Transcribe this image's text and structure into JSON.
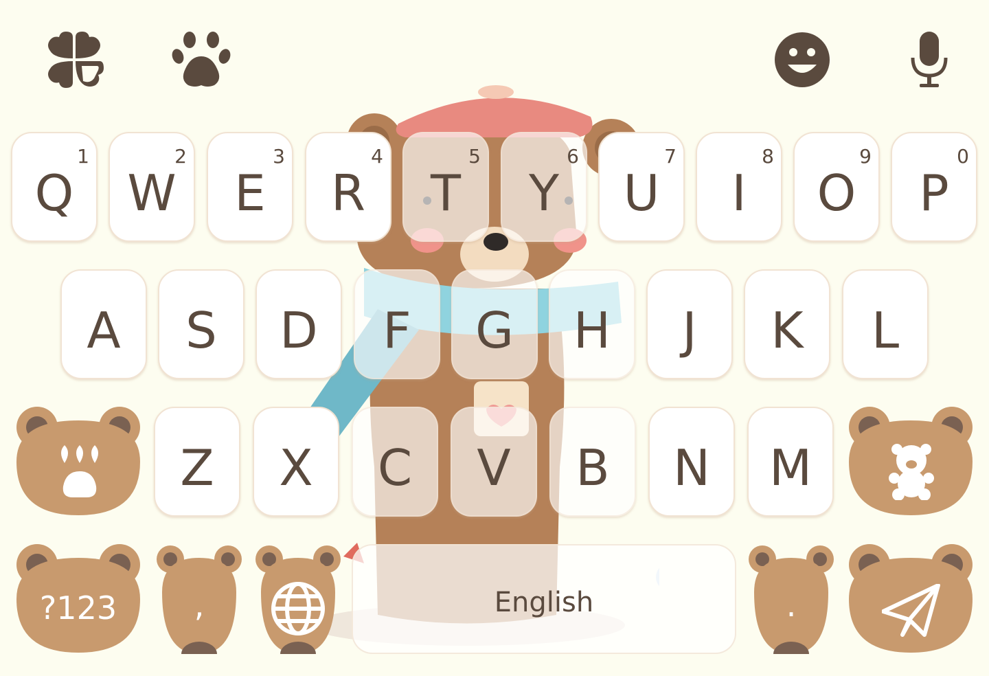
{
  "colors": {
    "background": "#fdfdf0",
    "key_fill": "#ffffff",
    "key_border": "#f1e3d3",
    "text": "#5a4a3e",
    "bear_face": "#c89a6e",
    "bear_ear_inner": "#7a6152",
    "icon": "#5a4a3e"
  },
  "toolbar": {
    "icons": [
      "clover-icon",
      "paw-icon",
      "emoji-icon",
      "microphone-icon"
    ]
  },
  "keyboard": {
    "row1": [
      {
        "letter": "Q",
        "hint": "1"
      },
      {
        "letter": "W",
        "hint": "2"
      },
      {
        "letter": "E",
        "hint": "3"
      },
      {
        "letter": "R",
        "hint": "4"
      },
      {
        "letter": "T",
        "hint": "5"
      },
      {
        "letter": "Y",
        "hint": "6"
      },
      {
        "letter": "U",
        "hint": "7"
      },
      {
        "letter": "I",
        "hint": "8"
      },
      {
        "letter": "O",
        "hint": "9"
      },
      {
        "letter": "P",
        "hint": "0"
      }
    ],
    "row2": [
      "A",
      "S",
      "D",
      "F",
      "G",
      "H",
      "J",
      "K",
      "L"
    ],
    "row3": [
      "Z",
      "X",
      "C",
      "V",
      "B",
      "N",
      "M"
    ],
    "symbols_label": "?123",
    "comma_label": ",",
    "space_label": "English",
    "period_label": ".",
    "shift_icon": "paw-print-icon",
    "sticker_icon": "teddy-bear-icon",
    "language_icon": "globe-icon",
    "enter_icon": "paper-plane-icon"
  }
}
